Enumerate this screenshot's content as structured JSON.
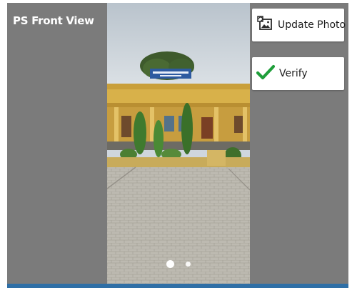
{
  "screen": {
    "title": "PS Front View"
  },
  "actions": {
    "update_photo_label": "Update Photo",
    "verify_label": "Verify"
  },
  "icons": {
    "update": "photo-update-icon",
    "verify": "checkmark-icon"
  },
  "carousel": {
    "image_count": 2,
    "current_index": 1
  },
  "colors": {
    "panel_background": "#7b7b7b",
    "bottom_bar": "#2f6fa6",
    "check_green": "#1f9e3a"
  }
}
